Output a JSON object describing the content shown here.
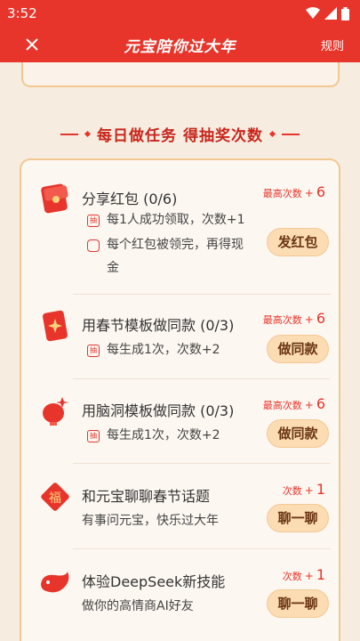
{
  "status": {
    "time": "3:52"
  },
  "header": {
    "title": "元宝陪你过大年",
    "rules": "规则"
  },
  "section": {
    "title": "每日做任务 得抽奖次数"
  },
  "tasks": [
    {
      "name": "分享红包 (0/6)",
      "reward_label": "最高次数",
      "reward_plus": "+",
      "reward_value": "6",
      "button": "发红包",
      "lines": [
        {
          "tag": "抽",
          "text": "每1人成功领取，次数+1"
        },
        {
          "tag": "",
          "text": "每个红包被领完，再得现"
        },
        {
          "tag": "",
          "text": "金"
        }
      ]
    },
    {
      "name": "用春节模板做同款 (0/3)",
      "reward_label": "最高次数",
      "reward_plus": "+",
      "reward_value": "6",
      "button": "做同款",
      "lines": [
        {
          "tag": "抽",
          "text": "每生成1次，次数+2"
        }
      ]
    },
    {
      "name": "用脑洞模板做同款 (0/3)",
      "reward_label": "最高次数",
      "reward_plus": "+",
      "reward_value": "6",
      "button": "做同款",
      "lines": [
        {
          "tag": "抽",
          "text": "每生成1次，次数+2"
        }
      ]
    },
    {
      "name": "和元宝聊聊春节话题",
      "reward_label": "次数",
      "reward_plus": "+",
      "reward_value": "1",
      "button": "聊一聊",
      "sub": "有事问元宝，快乐过大年"
    },
    {
      "name": "体验DeepSeek新技能",
      "reward_label": "次数",
      "reward_plus": "+",
      "reward_value": "1",
      "button": "聊一聊",
      "sub": "做你的高情商AI好友"
    }
  ],
  "icons": {
    "close": "close-icon",
    "wifi": "wifi-icon",
    "signal": "signal-icon",
    "battery": "battery-icon",
    "task_0": "red-envelope-icon",
    "task_1": "red-card-icon",
    "task_2": "lantern-icon",
    "task_3": "fu-icon",
    "task_4": "whale-icon"
  },
  "colors": {
    "accent": "#e8352b",
    "button_bg": "#fbdcb3",
    "card_border": "#f1c891"
  }
}
